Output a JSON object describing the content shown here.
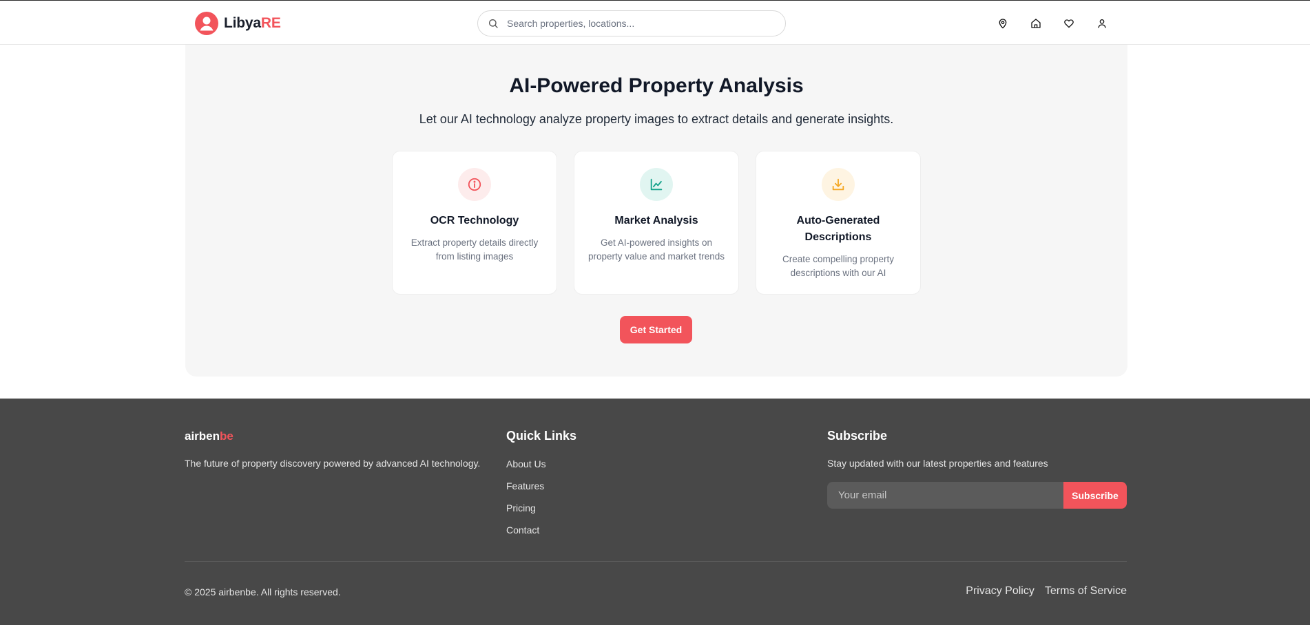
{
  "header": {
    "logo": {
      "prefix": "Libya",
      "accent": "RE",
      "icon": "user-circle-icon"
    },
    "search": {
      "placeholder": "Search properties, locations...",
      "value": "",
      "icon": "search-icon"
    },
    "nav_icons": [
      "map-pin-icon",
      "home-icon",
      "heart-icon",
      "user-icon"
    ]
  },
  "analysis": {
    "title": "AI-Powered Property Analysis",
    "subtitle": "Let our AI technology analyze property images to extract details and generate insights.",
    "cards": [
      {
        "title": "OCR Technology",
        "description": "Extract property details directly from listing images",
        "icon": "info-icon",
        "icon_color": "#f2545b",
        "icon_bg": "#fdecec"
      },
      {
        "title": "Market Analysis",
        "description": "Get AI-powered insights on property value and market trends",
        "icon": "line-chart-icon",
        "icon_color": "#14a38b",
        "icon_bg": "#e1f5f1"
      },
      {
        "title": "Auto-Generated Descriptions",
        "description": "Create compelling property descriptions with our AI",
        "icon": "download-icon",
        "icon_color": "#f4a825",
        "icon_bg": "#fef4e2"
      }
    ],
    "cta_label": "Get Started"
  },
  "footer": {
    "brand": {
      "prefix": "airben",
      "accent": "be"
    },
    "brand_description": "The future of property discovery powered by advanced AI technology.",
    "quick_links": {
      "title": "Quick Links",
      "items": [
        "About Us",
        "Features",
        "Pricing",
        "Contact"
      ]
    },
    "subscribe": {
      "title": "Subscribe",
      "description": "Stay updated with our latest properties and features",
      "email_placeholder": "Your email",
      "button_label": "Subscribe"
    },
    "copyright": "© 2025 airbenbe. All rights reserved.",
    "legal_links": [
      "Privacy Policy",
      "Terms of Service"
    ]
  },
  "colors": {
    "accent": "#f2545b",
    "footer_bg": "#484848",
    "section_bg": "#f6f6f6"
  }
}
